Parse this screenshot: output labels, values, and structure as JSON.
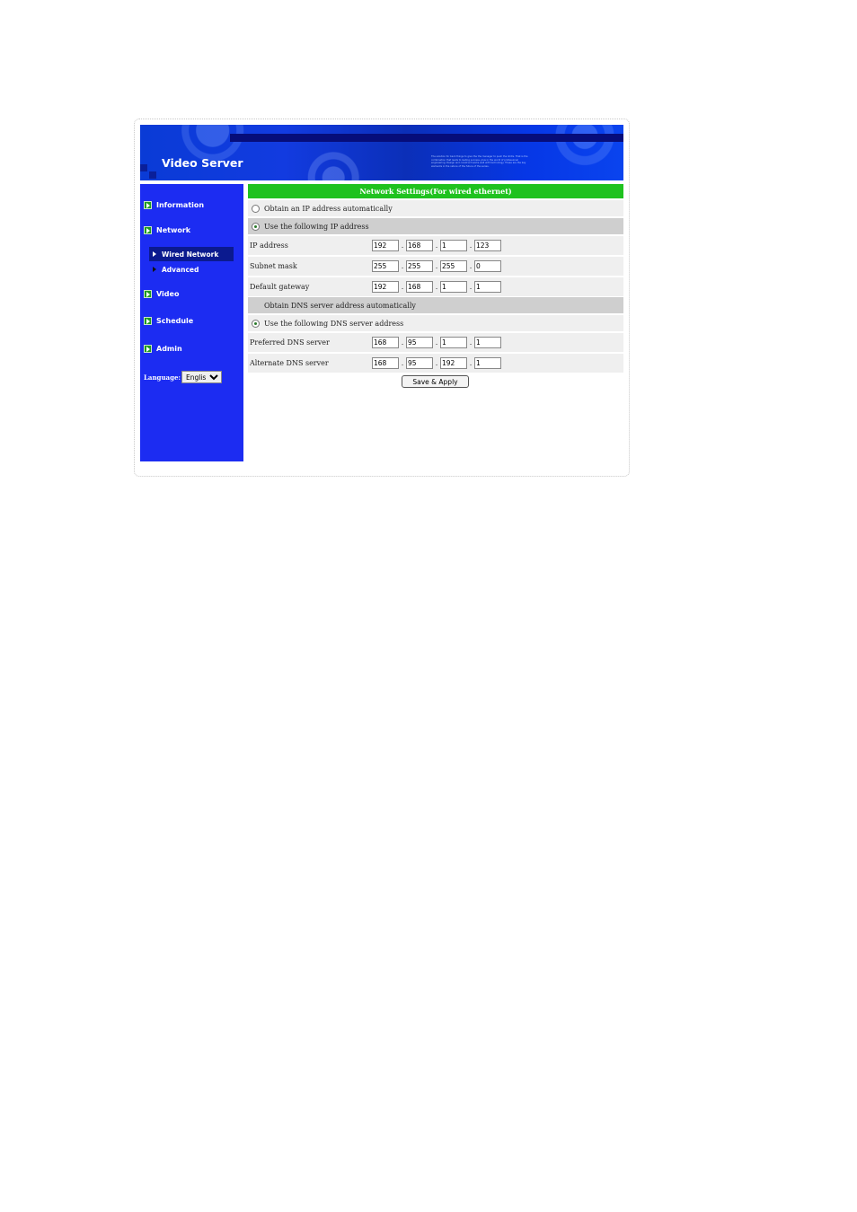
{
  "banner": {
    "title": "Video Server",
    "blurb": "The solution for back things to give the the manager to push the limits. That is the combination that leads to lasting success, plus in the world of professional engineering. Design and construct works well with technology. These are the key elements in the nature of the future of the series."
  },
  "sidebar": {
    "items": [
      {
        "label": "Information"
      },
      {
        "label": "Network"
      },
      {
        "label": "Video"
      },
      {
        "label": "Schedule"
      },
      {
        "label": "Admin"
      }
    ],
    "network_sub": [
      {
        "label": "Wired Network"
      },
      {
        "label": "Advanced"
      }
    ],
    "language_label": "Language:",
    "language_value": "English"
  },
  "main": {
    "header": "Network Settings(For wired ethernet)",
    "obtain_ip_auto": "Obtain an IP address automatically",
    "use_following_ip": "Use the following IP address",
    "ip_label": "IP address",
    "ip": [
      "192",
      "168",
      "1",
      "123"
    ],
    "subnet_label": "Subnet mask",
    "subnet": [
      "255",
      "255",
      "255",
      "0"
    ],
    "gateway_label": "Default gateway",
    "gateway": [
      "192",
      "168",
      "1",
      "1"
    ],
    "obtain_dns_auto": "Obtain DNS server address automatically",
    "use_following_dns": "Use the following DNS server address",
    "pref_dns_label": "Preferred DNS server",
    "pref_dns": [
      "168",
      "95",
      "1",
      "1"
    ],
    "alt_dns_label": "Alternate DNS server",
    "alt_dns": [
      "168",
      "95",
      "192",
      "1"
    ],
    "save_label": "Save & Apply"
  }
}
